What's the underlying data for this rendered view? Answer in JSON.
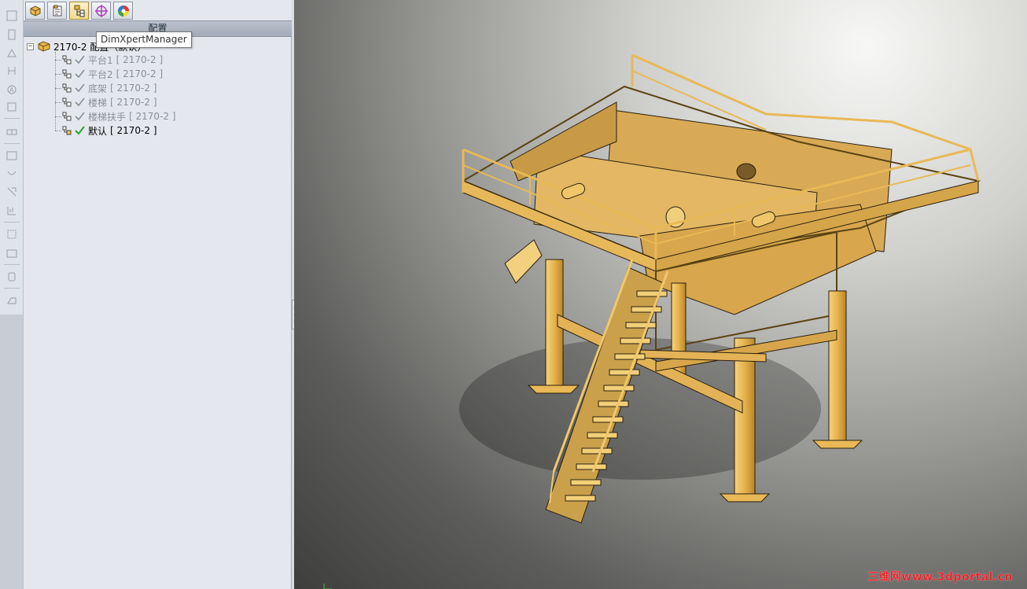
{
  "manager_tabs": [
    {
      "name": "FeatureManager",
      "active": false
    },
    {
      "name": "PropertyManager",
      "active": false
    },
    {
      "name": "ConfigurationManager",
      "active": true
    },
    {
      "name": "DimXpertManager",
      "active": false
    },
    {
      "name": "DisplayManager",
      "active": false
    }
  ],
  "tooltip": {
    "text": "DimXpertManager"
  },
  "panel": {
    "header": "配置"
  },
  "tree": {
    "root": {
      "label": "2170-2 配置（默认）",
      "expander": "−"
    },
    "items": [
      {
        "label": "平台1",
        "config": "[ 2170-2 ]",
        "active": false
      },
      {
        "label": "平台2",
        "config": "[ 2170-2 ]",
        "active": false
      },
      {
        "label": "底架",
        "config": "[ 2170-2 ]",
        "active": false
      },
      {
        "label": "楼梯",
        "config": "[ 2170-2 ]",
        "active": false
      },
      {
        "label": "楼梯扶手",
        "config": "[ 2170-2 ]",
        "active": false
      },
      {
        "label": "默认",
        "config": "[ 2170-2 ]",
        "active": true
      }
    ]
  },
  "viewport": {
    "model_color": "#e8b956",
    "watermark": "三维网www.3dportal.cn"
  },
  "colors": {
    "accent_check": "#2aa42a",
    "inactive_text": "#8a8f97",
    "watermark": "#e8262b"
  }
}
